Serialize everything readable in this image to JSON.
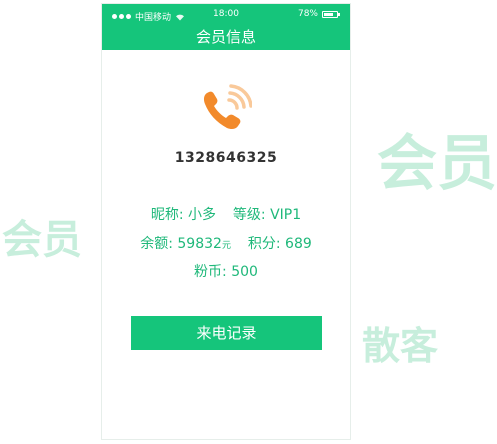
{
  "floating_labels": {
    "vip_big": "会员",
    "vip_small": "会员",
    "guest": "散客"
  },
  "status_bar": {
    "carrier": "中国移动",
    "time": "18:00",
    "battery": "78%",
    "battery_level": 0.78
  },
  "nav": {
    "title": "会员信息"
  },
  "caller": {
    "phone_number": "1328646325"
  },
  "member": {
    "nickname_label": "昵称:",
    "nickname": "小多",
    "level_label": "等级:",
    "level": "VIP1",
    "balance_label": "余额:",
    "balance": "59832",
    "balance_unit": "元",
    "points_label": "积分:",
    "points": "689",
    "coins_label": "粉币:",
    "coins": "500"
  },
  "actions": {
    "call_record_label": "来电记录"
  },
  "colors": {
    "accent": "#15c57b",
    "info_text": "#1fb87a",
    "phone_icon": "#f28a2b",
    "floating_label": "#c7eedc"
  },
  "icons": {
    "caller_icon": "phone-ringing-icon",
    "wifi": "wifi-icon",
    "battery": "battery-icon"
  }
}
